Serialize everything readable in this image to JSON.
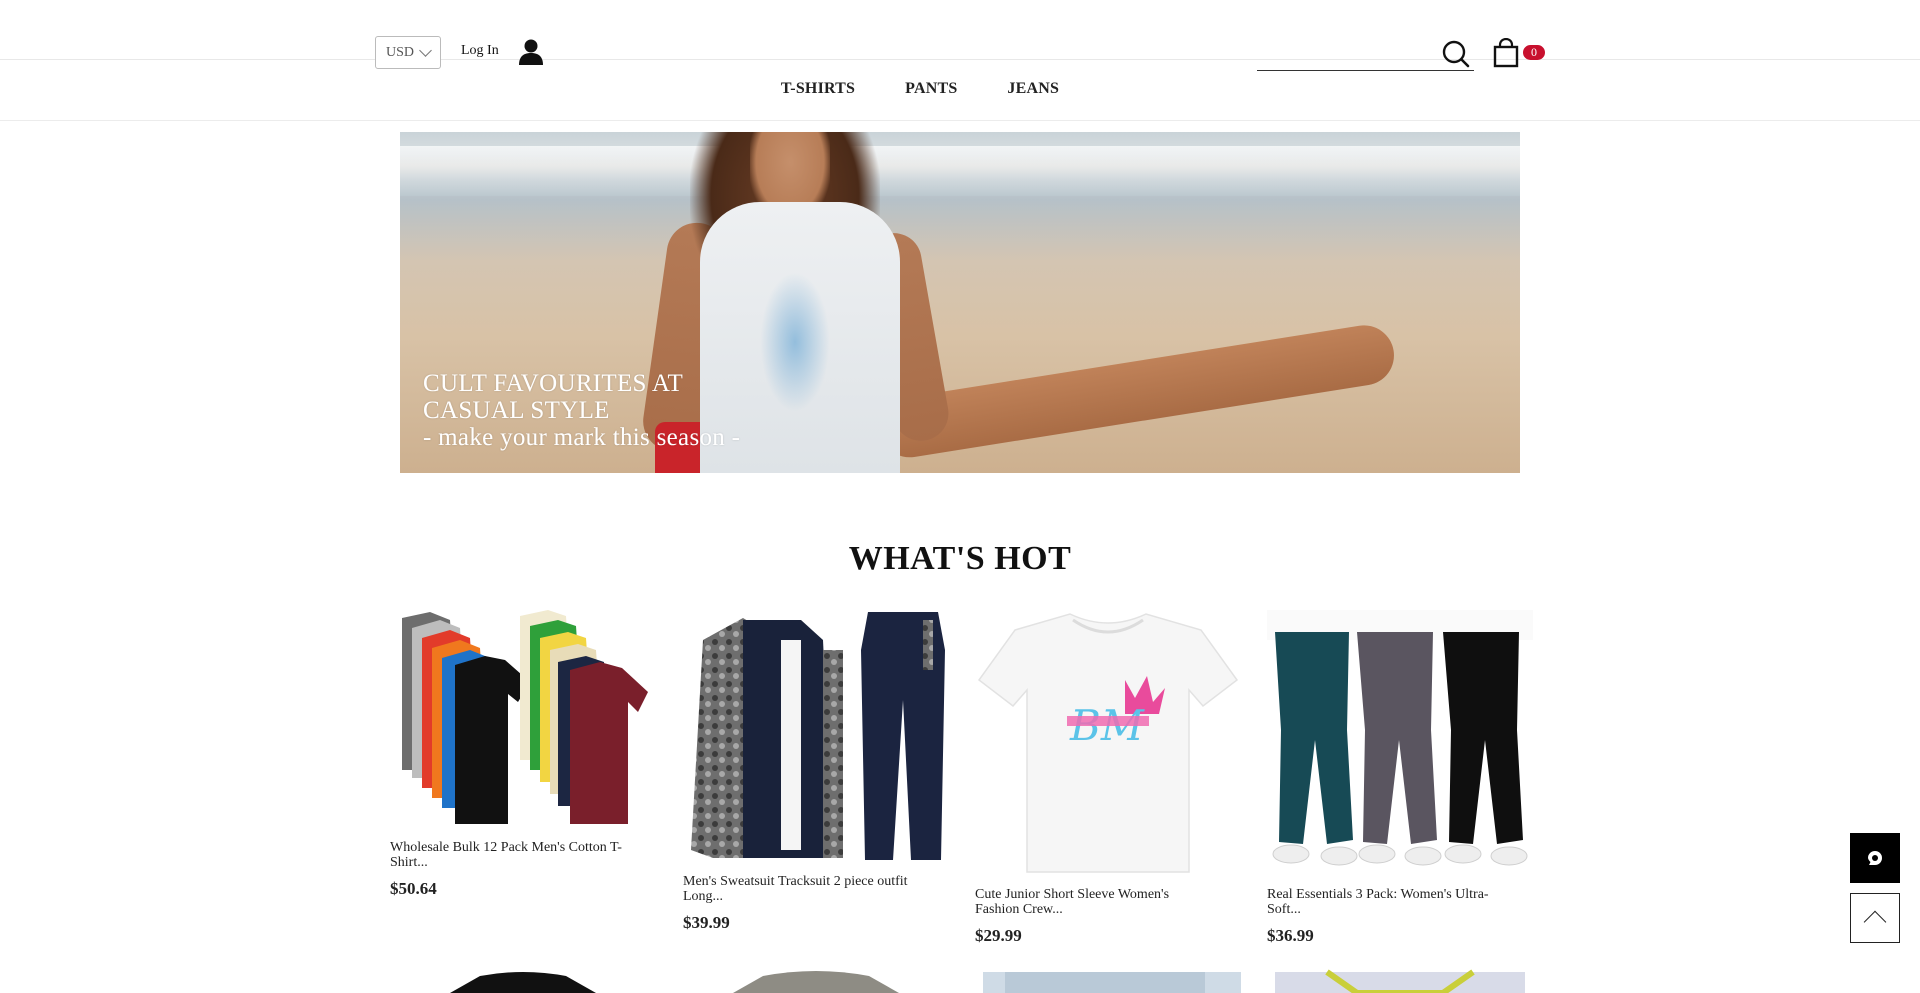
{
  "header": {
    "currency": "USD",
    "login_label": "Log In",
    "cart_count": "0",
    "icons": {
      "user": "user-icon",
      "search": "search-icon",
      "cart": "shopping-bag-icon",
      "chevron": "chevron-down-icon"
    }
  },
  "nav": {
    "items": [
      {
        "label": "T-SHIRTS"
      },
      {
        "label": "PANTS"
      },
      {
        "label": "JEANS"
      }
    ]
  },
  "hero": {
    "line1": "CULT FAVOURITES AT",
    "line2": "CASUAL STYLE",
    "line3": "- make your mark this season -"
  },
  "section": {
    "title": "WHAT'S HOT"
  },
  "products": [
    {
      "name": "Wholesale Bulk 12 Pack Men's Cotton T-Shirt...",
      "price": "$50.64"
    },
    {
      "name": "Men's Sweatsuit Tracksuit 2 piece outfit Long...",
      "price": "$39.99"
    },
    {
      "name": "Cute Junior Short Sleeve Women's Fashion Crew...",
      "price": "$29.99"
    },
    {
      "name": "Real Essentials 3 Pack: Women's Ultra-Soft...",
      "price": "$36.99"
    }
  ],
  "floating": {
    "chat_icon": "chat-icon",
    "back_to_top_icon": "chevron-up-icon"
  },
  "colors": {
    "badge": "#c8102e",
    "text": "#111111"
  }
}
